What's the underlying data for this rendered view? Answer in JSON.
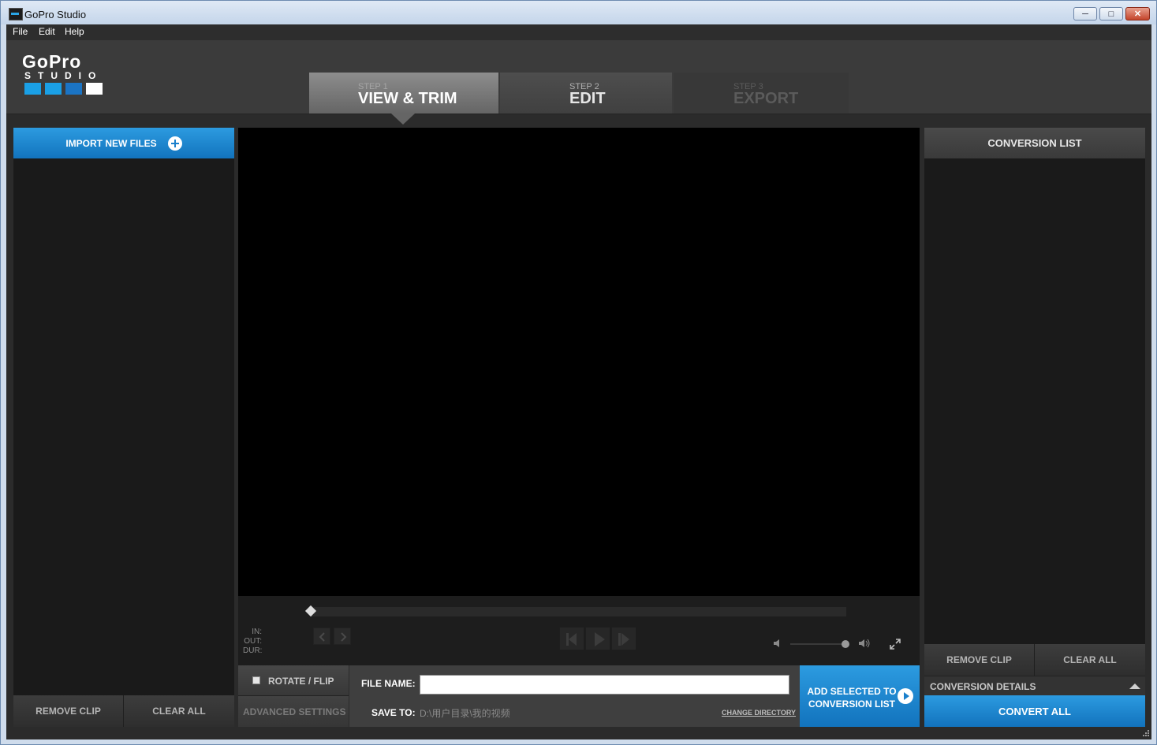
{
  "window": {
    "title": "GoPro Studio"
  },
  "menu": {
    "items": [
      "File",
      "Edit",
      "Help"
    ]
  },
  "logo": {
    "name": "GoPro",
    "sub": "STUDIO",
    "squares": [
      "#1aa0e6",
      "#1aa0e6",
      "#1b74c4",
      "#ffffff"
    ]
  },
  "steps": [
    {
      "step": "STEP 1",
      "label": "VIEW & TRIM",
      "state": "active"
    },
    {
      "step": "STEP 2",
      "label": "EDIT",
      "state": "enabled"
    },
    {
      "step": "STEP 3",
      "label": "EXPORT",
      "state": "disabled"
    }
  ],
  "left_panel": {
    "import_label": "IMPORT NEW FILES",
    "remove_label": "REMOVE CLIP",
    "clear_label": "CLEAR ALL"
  },
  "player": {
    "in_label": "IN:",
    "out_label": "OUT:",
    "dur_label": "DUR:",
    "volume_level": 0.97,
    "position": 0.0
  },
  "bottom": {
    "rotate_label": "ROTATE / FLIP",
    "advanced_label": "ADVANCED SETTINGS",
    "file_name_label": "FILE NAME:",
    "file_name_value": "",
    "save_to_label": "SAVE TO:",
    "save_to_value": "D:\\用户目录\\我的视频",
    "change_dir_label": "CHANGE DIRECTORY",
    "add_line1": "ADD SELECTED TO",
    "add_line2": "CONVERSION LIST"
  },
  "right_panel": {
    "title": "CONVERSION LIST",
    "remove_label": "REMOVE CLIP",
    "clear_label": "CLEAR ALL",
    "details_label": "CONVERSION DETAILS",
    "convert_label": "CONVERT ALL"
  },
  "colors": {
    "accent": "#1a8ad6",
    "background": "#2b2b2b"
  }
}
